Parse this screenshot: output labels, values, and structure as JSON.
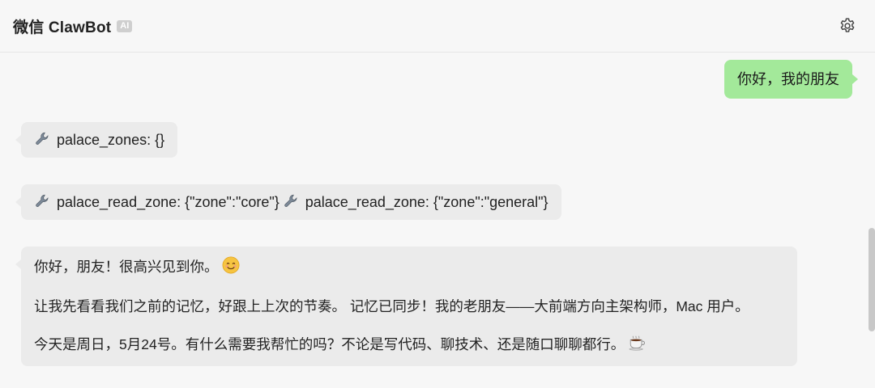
{
  "header": {
    "title": "微信 ClawBot",
    "badge": "AI",
    "settings_icon": "gear-icon"
  },
  "messages": [
    {
      "role": "user",
      "text": "你好，我的朋友"
    },
    {
      "role": "tool",
      "icon": "wrench-icon",
      "text": "palace_zones: {}"
    },
    {
      "role": "tool",
      "icon": "wrench-icon",
      "calls": [
        "palace_read_zone: {\"zone\":\"core\"}",
        "palace_read_zone: {\"zone\":\"general\"}"
      ]
    },
    {
      "role": "assistant",
      "lines": [
        "你好，朋友！很高兴见到你。",
        "让我先看看我们之前的记忆，好跟上上次的节奏。 记忆已同步！我的老朋友——大前端方向主架构师，Mac 用户。",
        "今天是周日，5月24号。有什么需要我帮忙的吗？不论是写代码、聊技术、还是随口聊聊都行。"
      ],
      "emoji": [
        "smiling-face-icon",
        "coffee-cup-icon"
      ]
    }
  ],
  "colors": {
    "user_bubble": "#a3e99a",
    "bot_bubble": "#ebebeb",
    "background": "#f7f7f7"
  }
}
